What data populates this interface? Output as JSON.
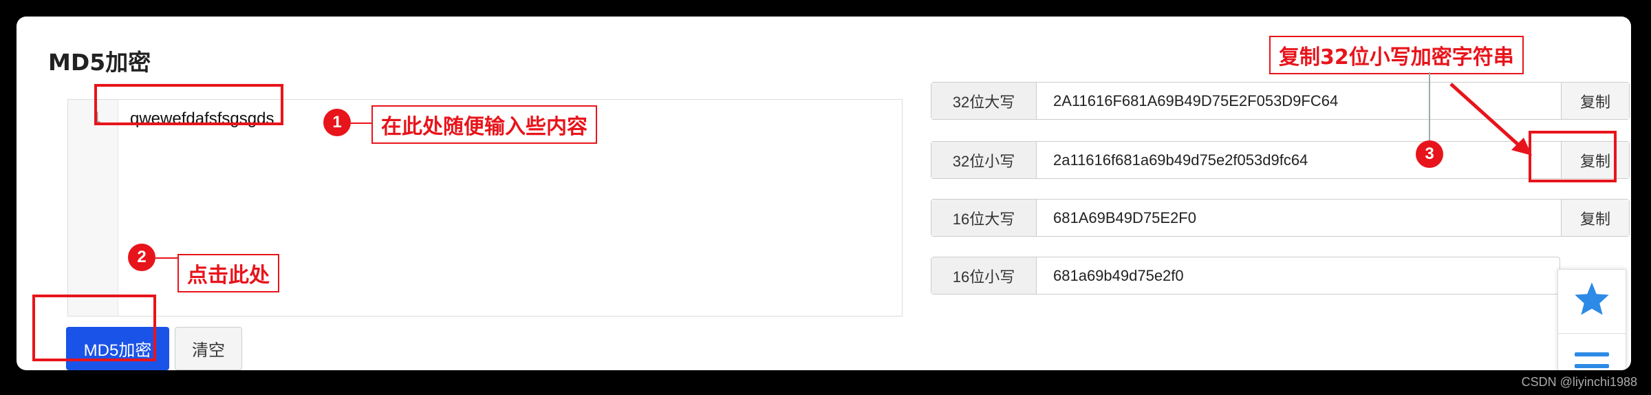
{
  "page_title": "MD5加密",
  "editor": {
    "line_number": "1",
    "content": "qwewefdafsfsgsgds"
  },
  "buttons": {
    "encrypt": "MD5加密",
    "clear": "清空"
  },
  "results": [
    {
      "label": "32位大写",
      "value": "2A11616F681A69B49D75E2F053D9FC64",
      "copy": "复制"
    },
    {
      "label": "32位小写",
      "value": "2a11616f681a69b49d75e2f053d9fc64",
      "copy": "复制"
    },
    {
      "label": "16位大写",
      "value": "681A69B49D75E2F0",
      "copy": "复制"
    },
    {
      "label": "16位小写",
      "value": "681a69b49d75e2f0"
    }
  ],
  "annotations": {
    "step1_number": "1",
    "step1_text": "在此处随便输入些内容",
    "step2_number": "2",
    "step2_text": "点击此处",
    "step3_number": "3",
    "step3_text": "复制32位小写加密字符串"
  },
  "float_panel": {
    "icons": [
      "star-icon",
      "menu-icon"
    ]
  },
  "watermark": "CSDN @liyinchi1988",
  "colors": {
    "annotation_red": "#e8141b",
    "primary_button": "#1a53e8",
    "star_blue": "#2d8ae6"
  }
}
